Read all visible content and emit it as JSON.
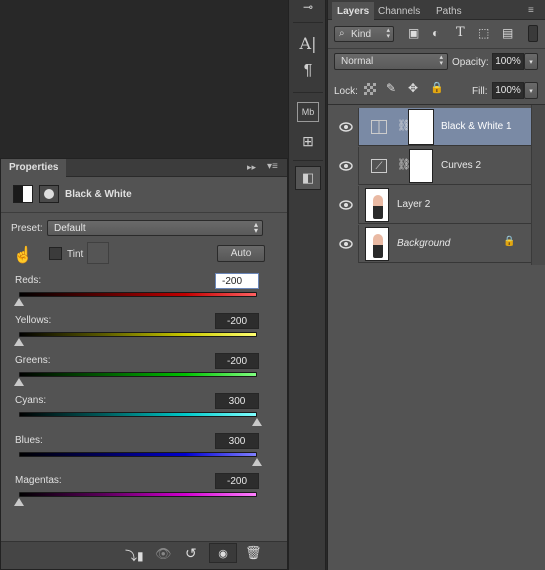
{
  "properties": {
    "tab_label": "Properties",
    "adjustment_name": "Black & White",
    "preset_label": "Preset:",
    "preset_value": "Default",
    "tint_label": "Tint",
    "auto_label": "Auto",
    "sliders": [
      {
        "label": "Reds:",
        "value": "-200",
        "fraction": 0.0,
        "gradient": "linear-gradient(90deg,#000 0%,#5a0000 35%,#c00000 70%,#ff6060 100%)"
      },
      {
        "label": "Yellows:",
        "value": "-200",
        "fraction": 0.0,
        "gradient": "linear-gradient(90deg,#000 0%,#5a5a00 35%,#c8c800 70%,#ffff70 100%)"
      },
      {
        "label": "Greens:",
        "value": "-200",
        "fraction": 0.0,
        "gradient": "linear-gradient(90deg,#000 0%,#005a00 35%,#00c000 70%,#80ff80 100%)"
      },
      {
        "label": "Cyans:",
        "value": "300",
        "fraction": 1.0,
        "gradient": "linear-gradient(90deg,#000 0%,#005a5a 35%,#00c8c8 70%,#80ffff 100%)"
      },
      {
        "label": "Blues:",
        "value": "300",
        "fraction": 1.0,
        "gradient": "linear-gradient(90deg,#000 0%,#00005a 35%,#0000d0 70%,#8080ff 100%)"
      },
      {
        "label": "Magentas:",
        "value": "-200",
        "fraction": 0.0,
        "gradient": "linear-gradient(90deg,#000 0%,#5a005a 35%,#d000d0 70%,#ff80ff 100%)"
      }
    ]
  },
  "layers_panel": {
    "tabs": [
      "Layers",
      "Channels",
      "Paths"
    ],
    "filter_kind": "Kind",
    "blend_mode": "Normal",
    "opacity_label": "Opacity:",
    "opacity_value": "100%",
    "lock_label": "Lock:",
    "fill_label": "Fill:",
    "fill_value": "100%",
    "layers": [
      {
        "name": "Black & White 1",
        "type": "adjustment-bw",
        "selected": true,
        "italic": false
      },
      {
        "name": "Curves 2",
        "type": "adjustment-curves",
        "selected": false,
        "italic": false
      },
      {
        "name": "Layer 2",
        "type": "image",
        "selected": false,
        "italic": false
      },
      {
        "name": "Background",
        "type": "image",
        "selected": false,
        "italic": true,
        "locked": true
      }
    ]
  },
  "toolbar": {
    "mb_label": "Mb"
  }
}
